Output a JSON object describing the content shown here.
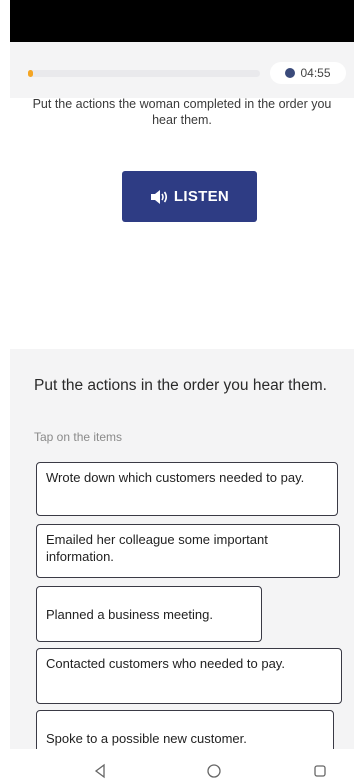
{
  "header": {
    "progress_fraction": 0.02,
    "timer": "04:55"
  },
  "prompt": "Put the actions the woman completed in the order you hear them.",
  "listen": {
    "label": "LISTEN",
    "icon": "speaker-icon"
  },
  "task": {
    "instruction": "Put the actions in the order you hear them.",
    "hint": "Tap on the items"
  },
  "options": [
    "Wrote down which customers needed to pay.",
    "Emailed her colleague some important information.",
    "Planned a business meeting.",
    "Contacted customers who needed to pay.",
    "Spoke to a possible new customer."
  ],
  "navbar": {
    "icons": [
      "back-triangle-icon",
      "home-circle-icon",
      "recent-apps-square-icon"
    ]
  },
  "colors": {
    "accent_button": "#2e3c84",
    "progress_fill": "#f4a524",
    "panel_bg": "#f4f4f5"
  }
}
